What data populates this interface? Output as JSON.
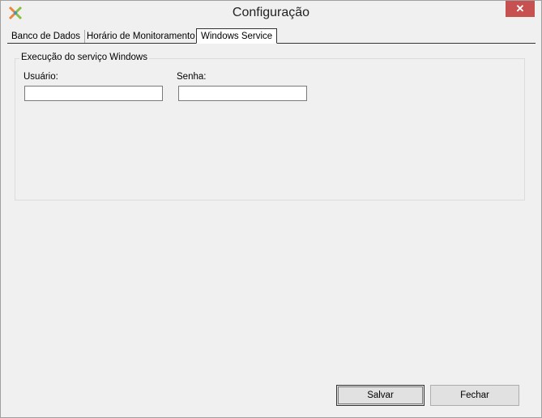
{
  "window": {
    "title": "Configuração",
    "close_label": "✕",
    "icon": "app-logo-icon"
  },
  "tabs": [
    {
      "label": "Banco de Dados"
    },
    {
      "label": "Horário de Monitoramento"
    },
    {
      "label": "Windows Service"
    }
  ],
  "groupbox": {
    "title": "Execução do serviço Windows",
    "user_label": "Usuário:",
    "user_value": "",
    "password_label": "Senha:",
    "password_value": ""
  },
  "buttons": {
    "save": "Salvar",
    "close": "Fechar"
  },
  "colors": {
    "close_button": "#c75050",
    "background": "#f0f0f0"
  }
}
